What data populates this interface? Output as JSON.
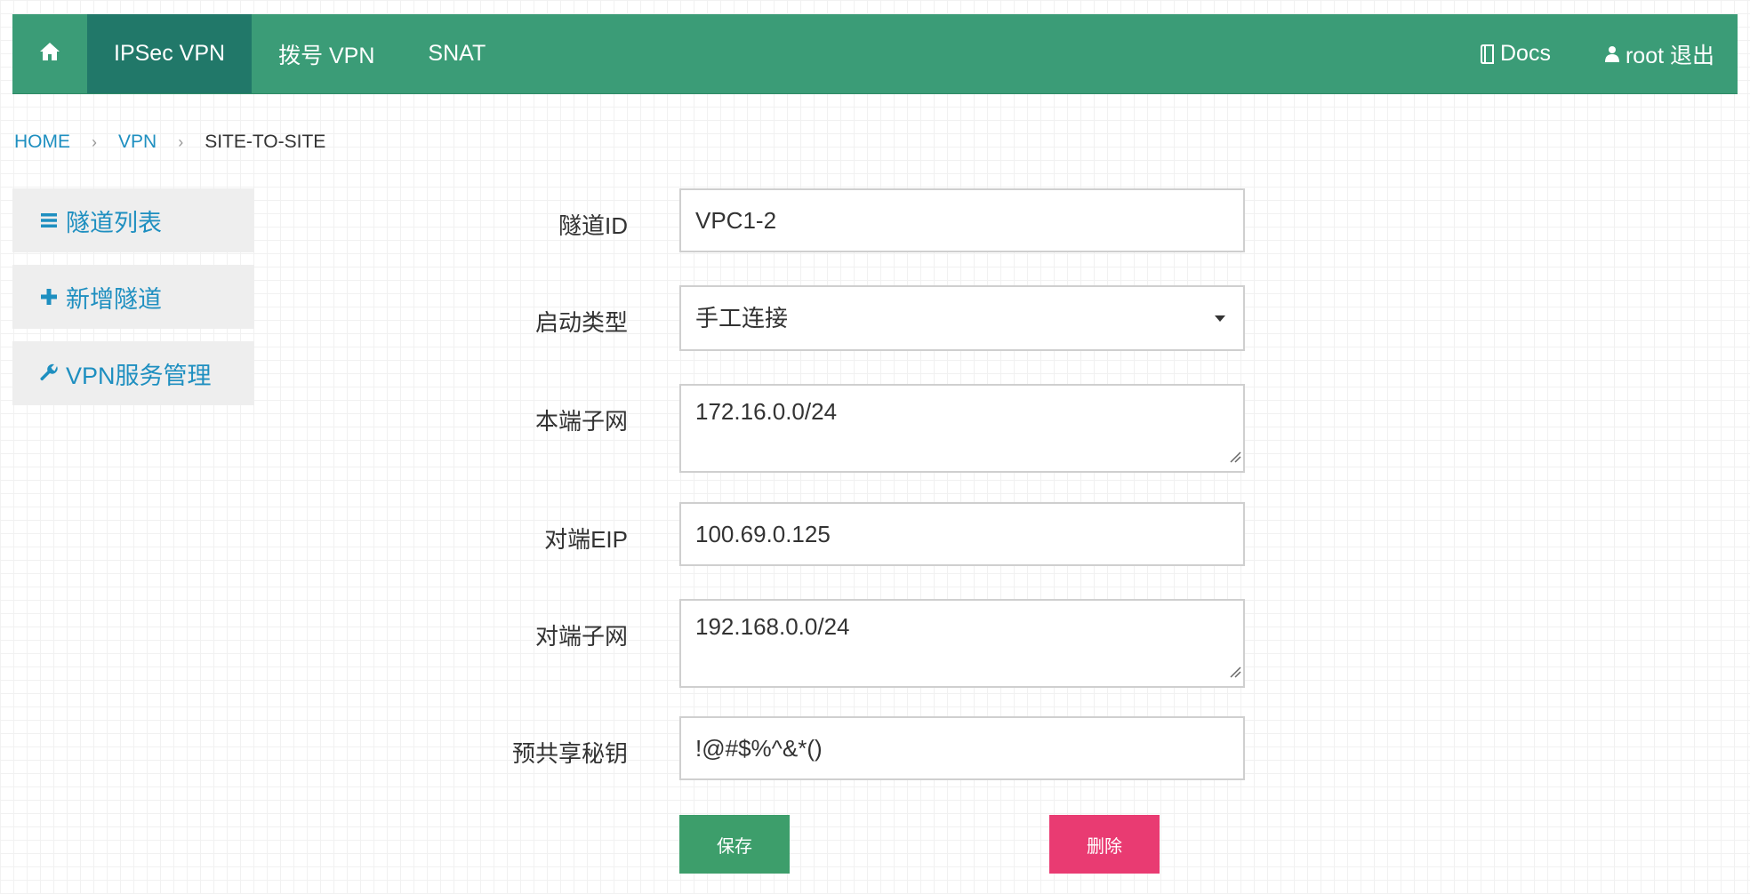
{
  "navbar": {
    "home_icon": "home-icon",
    "items": [
      {
        "label": "IPSec VPN",
        "active": true
      },
      {
        "label": "拨号 VPN",
        "active": false
      },
      {
        "label": "SNAT",
        "active": false
      }
    ],
    "docs_icon": "book-icon",
    "docs_label": "Docs",
    "user_icon": "user-icon",
    "user_label": "root 退出",
    "colors": {
      "bar": "#3b9c77",
      "active": "#217869"
    }
  },
  "breadcrumb": {
    "items": [
      "HOME",
      "VPN",
      "SITE-TO-SITE"
    ],
    "separator": "›"
  },
  "sidebar": {
    "items": [
      {
        "icon": "list-icon",
        "label": "隧道列表"
      },
      {
        "icon": "plus-icon",
        "label": "新增隧道"
      },
      {
        "icon": "wrench-icon",
        "label": "VPN服务管理"
      }
    ]
  },
  "form": {
    "tunnel_id": {
      "label": "隧道ID",
      "value": "VPC1-2"
    },
    "start_type": {
      "label": "启动类型",
      "value": "手工连接"
    },
    "local_subnet": {
      "label": "本端子网",
      "value": "172.16.0.0/24"
    },
    "peer_eip": {
      "label": "对端EIP",
      "value": "100.69.0.125"
    },
    "peer_subnet": {
      "label": "对端子网",
      "value": "192.168.0.0/24"
    },
    "psk": {
      "label": "预共享秘钥",
      "value": "!@#$%^&*()"
    }
  },
  "buttons": {
    "save": "保存",
    "delete": "删除",
    "colors": {
      "save": "#3d9e6b",
      "delete": "#e93b72"
    }
  }
}
